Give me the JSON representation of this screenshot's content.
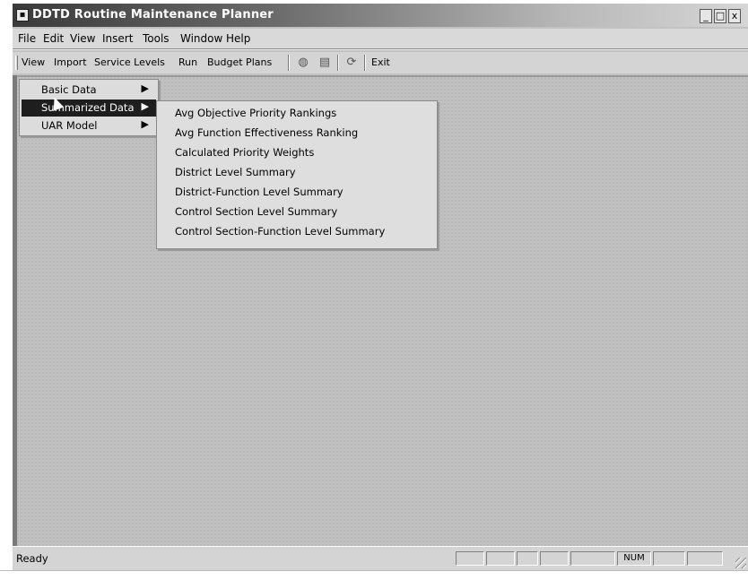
{
  "window": {
    "title": "DDTD Routine Maintenance Planner",
    "icon": "app-icon",
    "controls": {
      "minimize": "_",
      "restore": "□",
      "close": "x"
    }
  },
  "menubar": {
    "items": [
      "File",
      "Edit",
      "View",
      "Insert",
      "Tools",
      "Window",
      "Help"
    ]
  },
  "toolbar": {
    "items": [
      "View",
      "Import",
      "Service Levels",
      "Run",
      "Budget Plans"
    ],
    "icons": [
      "globe-icon",
      "print-preview-icon",
      "refresh-icon"
    ],
    "exit_label": "Exit"
  },
  "view_menu": {
    "items": [
      {
        "label": "Basic Data",
        "has_submenu": true,
        "selected": false
      },
      {
        "label": "Summarized Data",
        "has_submenu": true,
        "selected": true
      },
      {
        "label": "UAR Model",
        "has_submenu": true,
        "selected": false
      }
    ]
  },
  "submenu": {
    "items": [
      "Avg Objective Priority Rankings",
      "Avg Function Effectiveness Ranking",
      "Calculated Priority Weights",
      "District Level Summary",
      "District-Function Level Summary",
      "Control Section Level Summary",
      "Control Section-Function Level Summary"
    ]
  },
  "statusbar": {
    "text": "Ready",
    "num_indicator": "NUM"
  }
}
